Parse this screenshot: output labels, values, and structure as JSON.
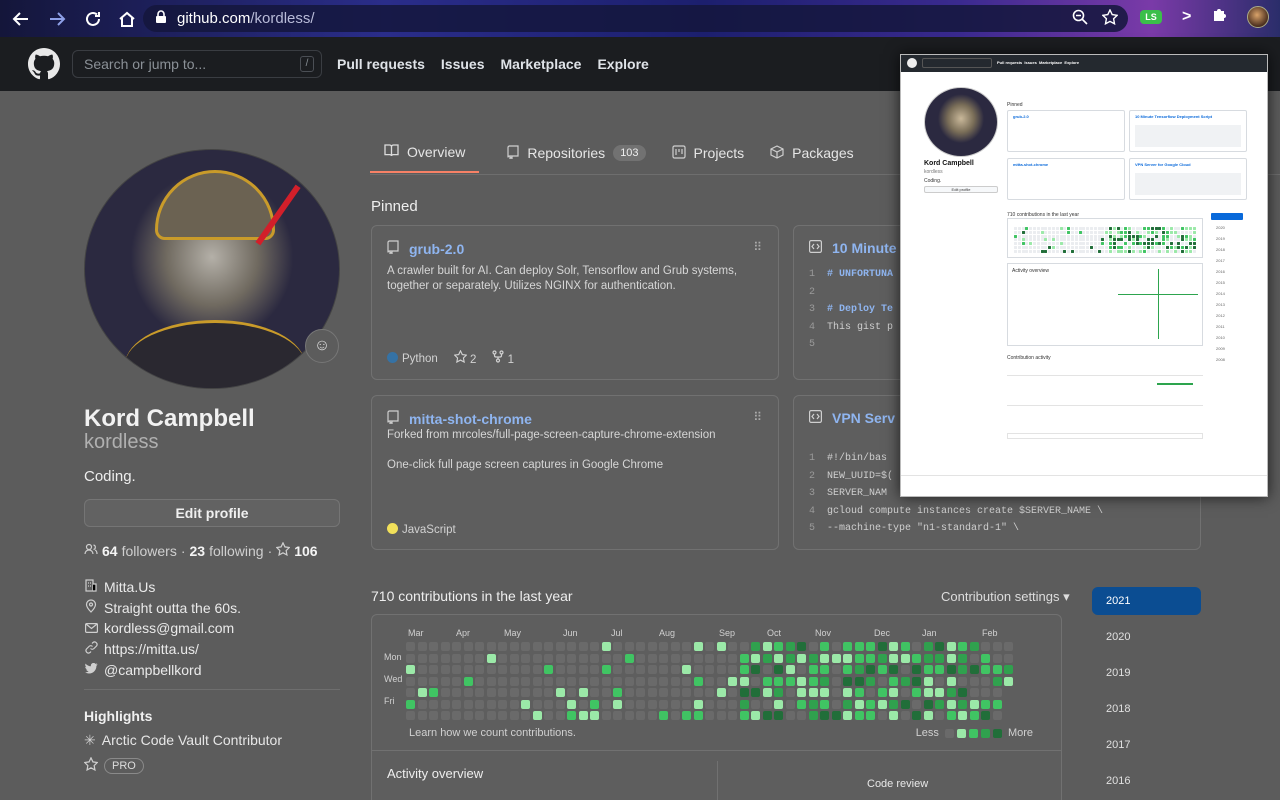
{
  "browser": {
    "url_host": "github.com",
    "url_path": "/kordless/",
    "extension_badge": "LS"
  },
  "header": {
    "search_placeholder": "Search or jump to...",
    "search_shortcut": "/",
    "nav": [
      "Pull requests",
      "Issues",
      "Marketplace",
      "Explore"
    ]
  },
  "profile": {
    "name": "Kord Campbell",
    "login": "kordless",
    "bio": "Coding.",
    "edit_label": "Edit profile",
    "followers": "64",
    "followers_label": "followers",
    "following": "23",
    "following_label": "following",
    "stars": "106",
    "company": "Mitta.Us",
    "location": "Straight outta the 60s.",
    "email": "kordless@gmail.com",
    "website": "https://mitta.us/",
    "twitter": "@campbellkord",
    "highlights_title": "Highlights",
    "highlight_vault": "Arctic Code Vault Contributor",
    "highlight_pro": "PRO"
  },
  "tabs": [
    {
      "label": "Overview",
      "icon": "book-icon"
    },
    {
      "label": "Repositories",
      "icon": "repo-icon",
      "count": "103"
    },
    {
      "label": "Projects",
      "icon": "project-icon"
    },
    {
      "label": "Packages",
      "icon": "package-icon"
    }
  ],
  "pinned_title": "Pinned",
  "pinned": [
    {
      "title": "grub-2.0",
      "description": "A crawler built for AI. Can deploy Solr, Tensorflow and Grub systems, together or separately. Utilizes NGINX for authentication.",
      "language": "Python",
      "language_color": "#3572A5",
      "stars": "2",
      "forks": "1"
    },
    {
      "title": "10 Minute",
      "lines": [
        {
          "n": "1",
          "text": "# UNFORTUNA",
          "comment": true
        },
        {
          "n": "2",
          "text": "",
          "comment": false
        },
        {
          "n": "3",
          "text": "# Deploy Te",
          "comment": true
        },
        {
          "n": "4",
          "text": "This gist p",
          "comment": false
        },
        {
          "n": "5",
          "text": "",
          "comment": false
        }
      ]
    },
    {
      "title": "mitta-shot-chrome",
      "forked_from": "Forked from mrcoles/full-page-screen-capture-chrome-extension",
      "description": "One-click full page screen captures in Google Chrome",
      "language": "JavaScript",
      "language_color": "#f1e05a"
    },
    {
      "title": "VPN Serv",
      "lines": [
        {
          "n": "1",
          "text": "#!/bin/bas"
        },
        {
          "n": "2",
          "text": "NEW_UUID=$("
        },
        {
          "n": "3",
          "text": "SERVER_NAM"
        },
        {
          "n": "4",
          "text": "gcloud compute instances create $SERVER_NAME \\"
        },
        {
          "n": "5",
          "text": "--machine-type \"n1-standard-1\" \\"
        }
      ]
    }
  ],
  "contributions": {
    "title": "710 contributions in the last year",
    "settings": "Contribution settings ▾",
    "months": [
      "Mar",
      "Apr",
      "May",
      "Jun",
      "Jul",
      "Aug",
      "Sep",
      "Oct",
      "Nov",
      "Dec",
      "Jan",
      "Feb"
    ],
    "days": [
      "Mon",
      "Wed",
      "Fri"
    ],
    "footer": "Learn how we count contributions.",
    "less": "Less",
    "more": "More",
    "activity_title": "Activity overview",
    "code_review": "Code review",
    "years": [
      "2021",
      "2020",
      "2019",
      "2018",
      "2017",
      "2016"
    ]
  },
  "colors": {
    "accent_tab": "#f78166",
    "link": "#8fb5f0",
    "year_active": "#0b4d92",
    "contrib_levels": [
      "#6a6a6a",
      "#9be9a8",
      "#40c463",
      "#30a14e",
      "#216e39"
    ]
  },
  "popup": {
    "name": "Kord Campbell",
    "login": "kordless",
    "bio": "Coding.",
    "edit": "Edit profile",
    "pinned": "Pinned",
    "cards": [
      "grub-2.0",
      "10 Minute Tensorflow Deployment Script",
      "mitta-shot-chrome",
      "VPN Server for Google Cloud"
    ],
    "contrib": "710 contributions in the last year",
    "activity": "Activity overview",
    "feed": "Contribution activity",
    "year": "2021",
    "years": [
      "2020",
      "2019",
      "2018",
      "2017",
      "2016",
      "2015",
      "2014",
      "2013",
      "2012",
      "2011",
      "2010",
      "2009",
      "2008"
    ]
  }
}
